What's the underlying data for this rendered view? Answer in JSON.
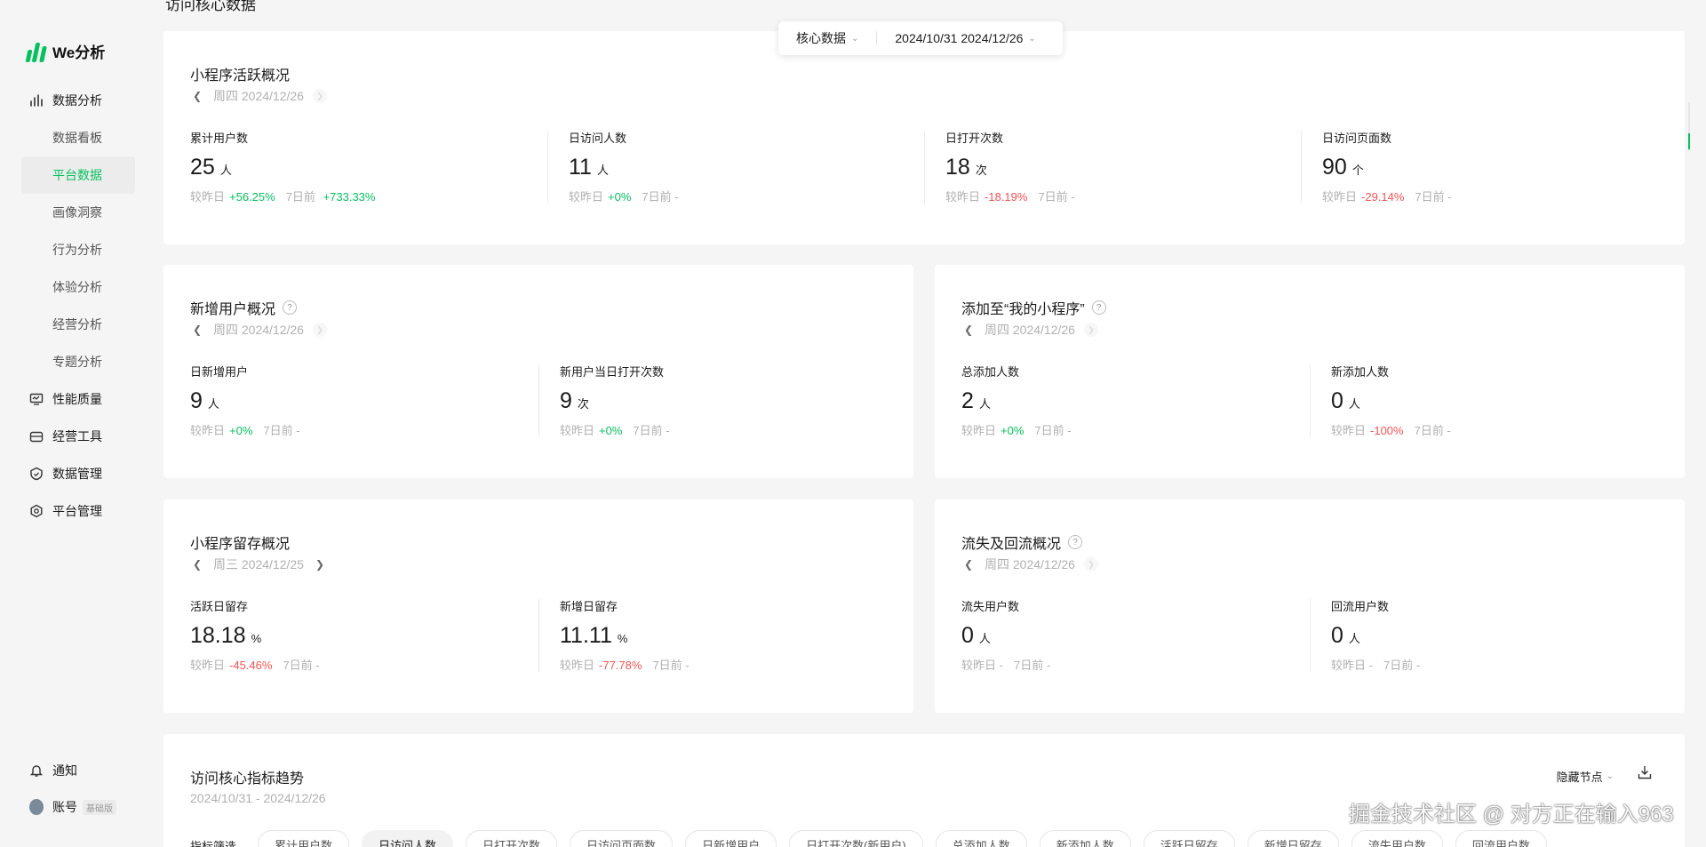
{
  "page": {
    "heading": "访问核心数据"
  },
  "brand": {
    "name": "We分析",
    "accent": "#07c160"
  },
  "sidebar": {
    "items": [
      {
        "label": "数据分析",
        "icon": "bar-chart-icon"
      },
      {
        "label": "数据看板"
      },
      {
        "label": "平台数据",
        "active": true
      },
      {
        "label": "画像洞察"
      },
      {
        "label": "行为分析"
      },
      {
        "label": "体验分析"
      },
      {
        "label": "经营分析"
      },
      {
        "label": "专题分析"
      },
      {
        "label": "性能质量",
        "icon": "monitor-icon"
      },
      {
        "label": "经营工具",
        "icon": "toolbox-icon"
      },
      {
        "label": "数据管理",
        "icon": "shield-icon"
      },
      {
        "label": "平台管理",
        "icon": "hexagon-gear-icon"
      }
    ],
    "notify": "通知",
    "account": "账号",
    "account_badge": "基础版"
  },
  "filter": {
    "select": "核心数据",
    "date_range": "2024/10/31  2024/12/26"
  },
  "cards": {
    "active": {
      "title": "小程序活跃概况",
      "date": "周四 2024/12/26",
      "metrics": [
        {
          "label": "累计用户数",
          "value": "25",
          "unit": "人",
          "cmp_label": "较昨日",
          "cmp": "+56.25%",
          "week_label": "7日前",
          "week": "+733.33%"
        },
        {
          "label": "日访问人数",
          "value": "11",
          "unit": "人",
          "cmp_label": "较昨日",
          "cmp": "+0%",
          "week_label": "7日前",
          "week": "-"
        },
        {
          "label": "日打开次数",
          "value": "18",
          "unit": "次",
          "cmp_label": "较昨日",
          "cmp": "-18.19%",
          "week_label": "7日前",
          "week": "-"
        },
        {
          "label": "日访问页面数",
          "value": "90",
          "unit": "个",
          "cmp_label": "较昨日",
          "cmp": "-29.14%",
          "week_label": "7日前",
          "week": "-"
        }
      ]
    },
    "new_users": {
      "title": "新增用户概况",
      "date": "周四 2024/12/26",
      "metrics": [
        {
          "label": "日新增用户",
          "value": "9",
          "unit": "人",
          "cmp_label": "较昨日",
          "cmp": "+0%",
          "week_label": "7日前",
          "week": "-"
        },
        {
          "label": "新用户当日打开次数",
          "value": "9",
          "unit": "次",
          "cmp_label": "较昨日",
          "cmp": "+0%",
          "week_label": "7日前",
          "week": "-"
        }
      ]
    },
    "added": {
      "title": "添加至“我的小程序”",
      "date": "周四 2024/12/26",
      "metrics": [
        {
          "label": "总添加人数",
          "value": "2",
          "unit": "人",
          "cmp_label": "较昨日",
          "cmp": "+0%",
          "week_label": "7日前",
          "week": "-"
        },
        {
          "label": "新添加人数",
          "value": "0",
          "unit": "人",
          "cmp_label": "较昨日",
          "cmp": "-100%",
          "week_label": "7日前",
          "week": "-"
        }
      ]
    },
    "retention": {
      "title": "小程序留存概况",
      "date": "周三 2024/12/25",
      "metrics": [
        {
          "label": "活跃日留存",
          "value": "18.18",
          "unit": "%",
          "cmp_label": "较昨日",
          "cmp": "-45.46%",
          "week_label": "7日前",
          "week": "-"
        },
        {
          "label": "新增日留存",
          "value": "11.11",
          "unit": "%",
          "cmp_label": "较昨日",
          "cmp": "-77.78%",
          "week_label": "7日前",
          "week": "-"
        }
      ]
    },
    "churn": {
      "title": "流失及回流概况",
      "date": "周四 2024/12/26",
      "metrics": [
        {
          "label": "流失用户数",
          "value": "0",
          "unit": "人",
          "cmp_label": "较昨日",
          "cmp": "-",
          "week_label": "7日前",
          "week": "-"
        },
        {
          "label": "回流用户数",
          "value": "0",
          "unit": "人",
          "cmp_label": "较昨日",
          "cmp": "-",
          "week_label": "7日前",
          "week": "-"
        }
      ]
    },
    "trend": {
      "title": "访问核心指标趋势",
      "range": "2024/10/31 - 2024/12/26",
      "hide_nodes": "隐藏节点",
      "filter_label": "指标筛选",
      "chips": [
        "累计用户数",
        "日访问人数",
        "日打开次数",
        "日访问页面数",
        "日新增用户",
        "日打开次数(新用户)",
        "总添加人数",
        "新添加人数",
        "活跃日留存",
        "新增日留存",
        "流失用户数",
        "回流用户数"
      ]
    }
  },
  "watermark": "掘金技术社区 @ 对方正在输入963"
}
